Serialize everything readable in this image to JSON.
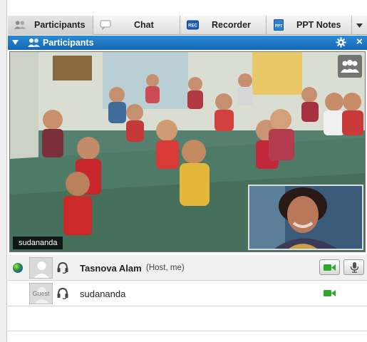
{
  "tabs": [
    {
      "label": "Participants",
      "icon": "participants-icon",
      "active": true
    },
    {
      "label": "Chat",
      "icon": "chat-bubble-icon",
      "active": false
    },
    {
      "label": "Recorder",
      "icon": "rec-icon",
      "badge": "REC",
      "active": false
    },
    {
      "label": "PPT Notes",
      "icon": "ppt-icon",
      "badge": "PPT",
      "active": false
    }
  ],
  "panel": {
    "title": "Participants"
  },
  "video": {
    "main_name_tag": "sudananda",
    "layout_icon": "people-layout-icon",
    "pip_icon": "presenter-video"
  },
  "participants": [
    {
      "name": "Tasnova Alam",
      "role": "(Host, me)",
      "avatar": "",
      "status_icon": "globe-status-icon",
      "audio_icon": "headset-icon",
      "video_on": true,
      "mic_control": true
    },
    {
      "name": "sudananda",
      "role": "",
      "avatar": "Guest",
      "status_icon": "",
      "audio_icon": "headset-icon",
      "video_on": true,
      "mic_control": false
    }
  ],
  "colors": {
    "header_blue": "#1d78c8",
    "video_green": "#2fa82f",
    "tab_bar": "#e2e2e2"
  }
}
